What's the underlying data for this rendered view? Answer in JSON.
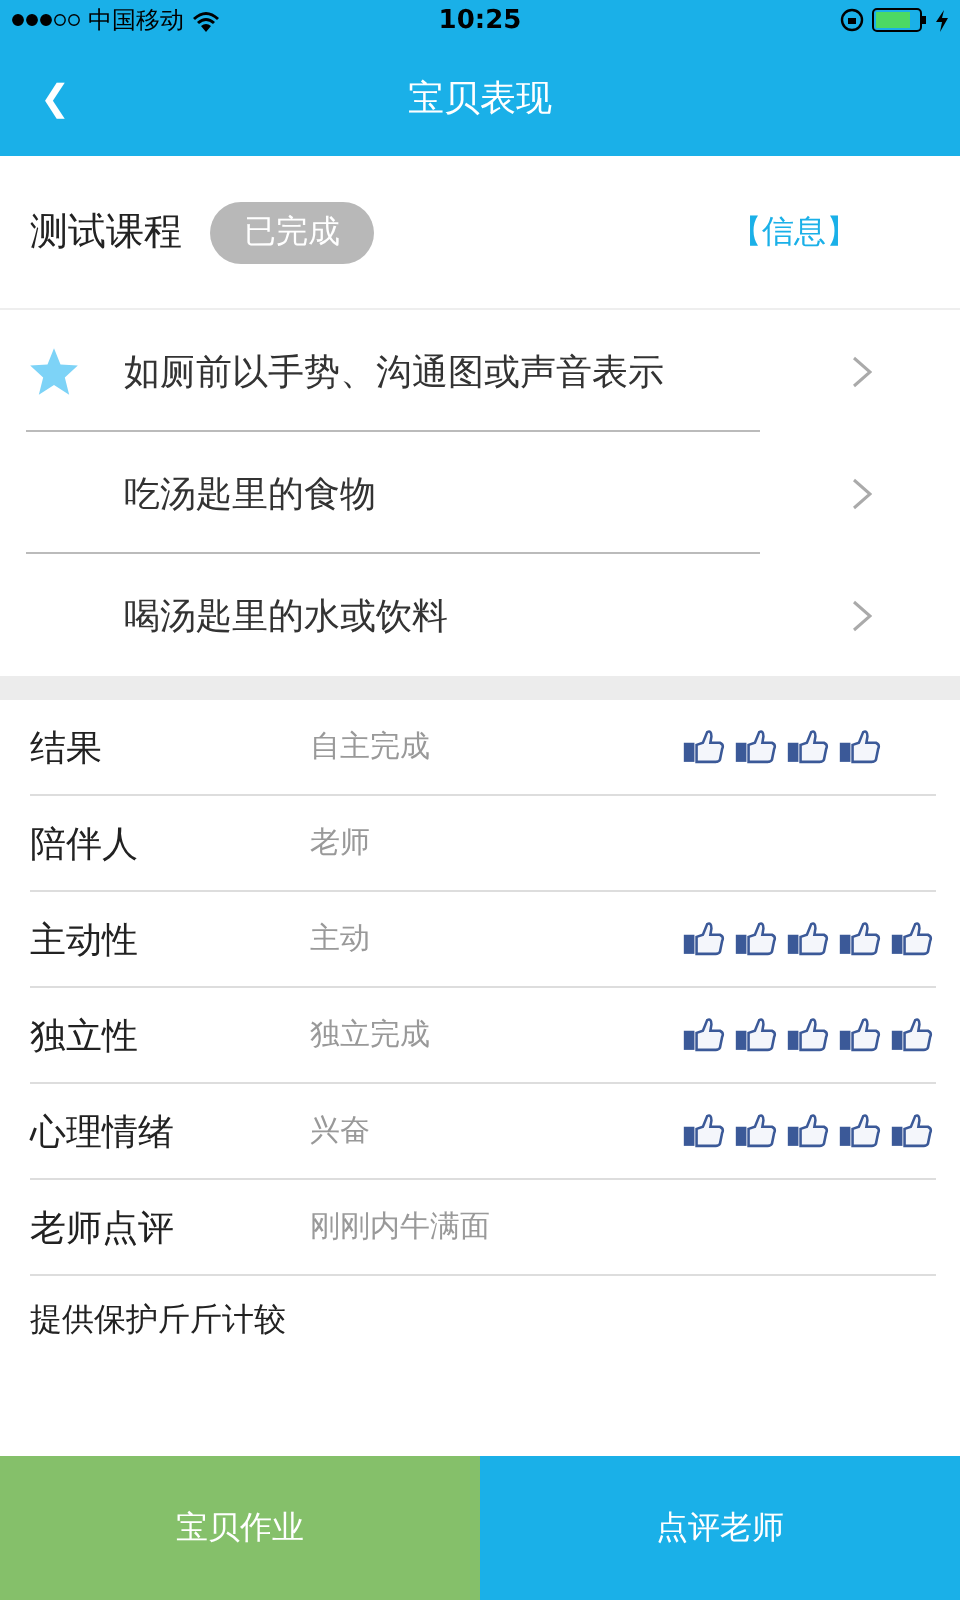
{
  "status_bar": {
    "carrier": "中国移动",
    "time": "10:25"
  },
  "nav": {
    "back": "❮",
    "title": "宝贝表现"
  },
  "course": {
    "name": "测试课程",
    "status": "已完成",
    "info": "【信息】"
  },
  "items": [
    {
      "text": "如厕前以手势、沟通图或声音表示",
      "starred": true
    },
    {
      "text": "吃汤匙里的食物",
      "starred": false
    },
    {
      "text": "喝汤匙里的水或饮料",
      "starred": false
    }
  ],
  "details": [
    {
      "label": "结果",
      "value": "自主完成",
      "thumbs": [
        {
          "filled": true
        },
        {
          "filled": true
        },
        {
          "filled": true
        },
        {
          "filled": true
        }
      ]
    },
    {
      "label": "陪伴人",
      "value": "老师"
    },
    {
      "label": "主动性",
      "value": "主动",
      "thumbs": [
        {
          "filled": true
        },
        {
          "filled": true
        },
        {
          "filled": true
        },
        {
          "filled": true
        },
        {
          "filled": true
        }
      ]
    },
    {
      "label": "独立性",
      "value": "独立完成",
      "thumbs": [
        {
          "filled": true
        },
        {
          "filled": true
        },
        {
          "filled": true
        },
        {
          "filled": true
        },
        {
          "filled": true
        }
      ]
    },
    {
      "label": "心理情绪",
      "value": "兴奋",
      "thumbs": [
        {
          "filled": true
        },
        {
          "filled": true
        },
        {
          "filled": true
        },
        {
          "filled": true
        },
        {
          "filled": true
        }
      ]
    },
    {
      "label": "老师点评",
      "value": "刚刚内牛满面"
    }
  ],
  "comment": "提供保护斤斤计较",
  "buttons": [
    {
      "label": "宝贝作业",
      "kind": "homework"
    },
    {
      "label": "点评老师",
      "kind": "review"
    }
  ]
}
